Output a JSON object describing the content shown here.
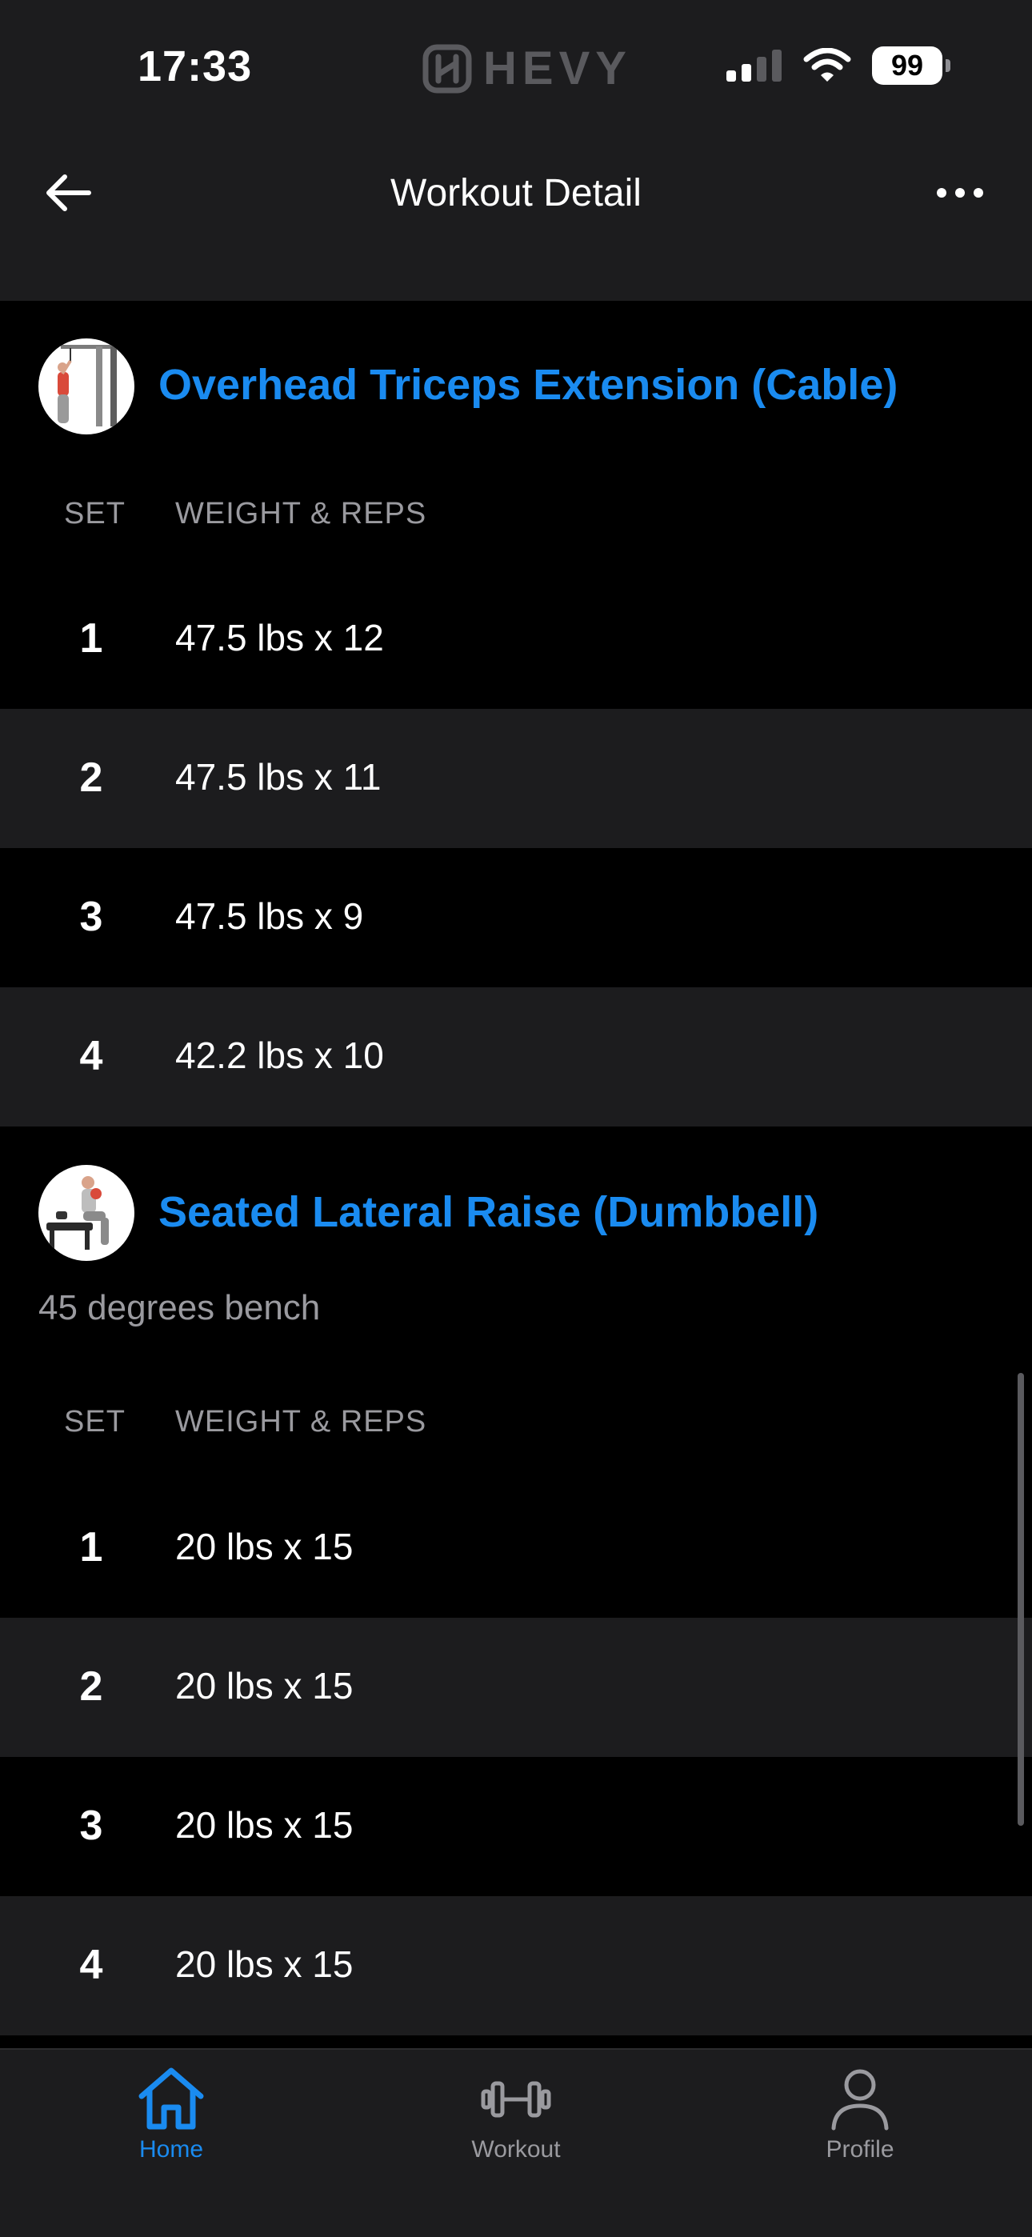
{
  "status_bar": {
    "time": "17:33",
    "app_name": "HEVY",
    "battery": "99"
  },
  "header": {
    "title": "Workout Detail",
    "back_icon": "arrow-left-icon",
    "more_icon": "ellipsis-icon"
  },
  "exercises": [
    {
      "title": "Overhead Triceps Extension (Cable)",
      "note": "",
      "col_set": "SET",
      "col_weight_reps": "WEIGHT & REPS",
      "sets": [
        {
          "num": "1",
          "value": "47.5 lbs x 12"
        },
        {
          "num": "2",
          "value": "47.5 lbs x 11"
        },
        {
          "num": "3",
          "value": "47.5 lbs x 9"
        },
        {
          "num": "4",
          "value": "42.2 lbs x 10"
        }
      ]
    },
    {
      "title": "Seated Lateral Raise (Dumbbell)",
      "note": "45 degrees bench",
      "col_set": "SET",
      "col_weight_reps": "WEIGHT & REPS",
      "sets": [
        {
          "num": "1",
          "value": "20 lbs x 15"
        },
        {
          "num": "2",
          "value": "20 lbs x 15"
        },
        {
          "num": "3",
          "value": "20 lbs x 15"
        },
        {
          "num": "4",
          "value": "20 lbs x 15"
        }
      ]
    }
  ],
  "tabbar": {
    "active": "Home",
    "tabs": [
      {
        "label": "Home",
        "icon": "home-icon"
      },
      {
        "label": "Workout",
        "icon": "dumbbell-icon"
      },
      {
        "label": "Profile",
        "icon": "person-icon"
      }
    ]
  },
  "colors": {
    "accent": "#1a8bf0",
    "background": "#000000",
    "surface": "#1c1c1e",
    "muted_text": "#9a9a9f"
  }
}
